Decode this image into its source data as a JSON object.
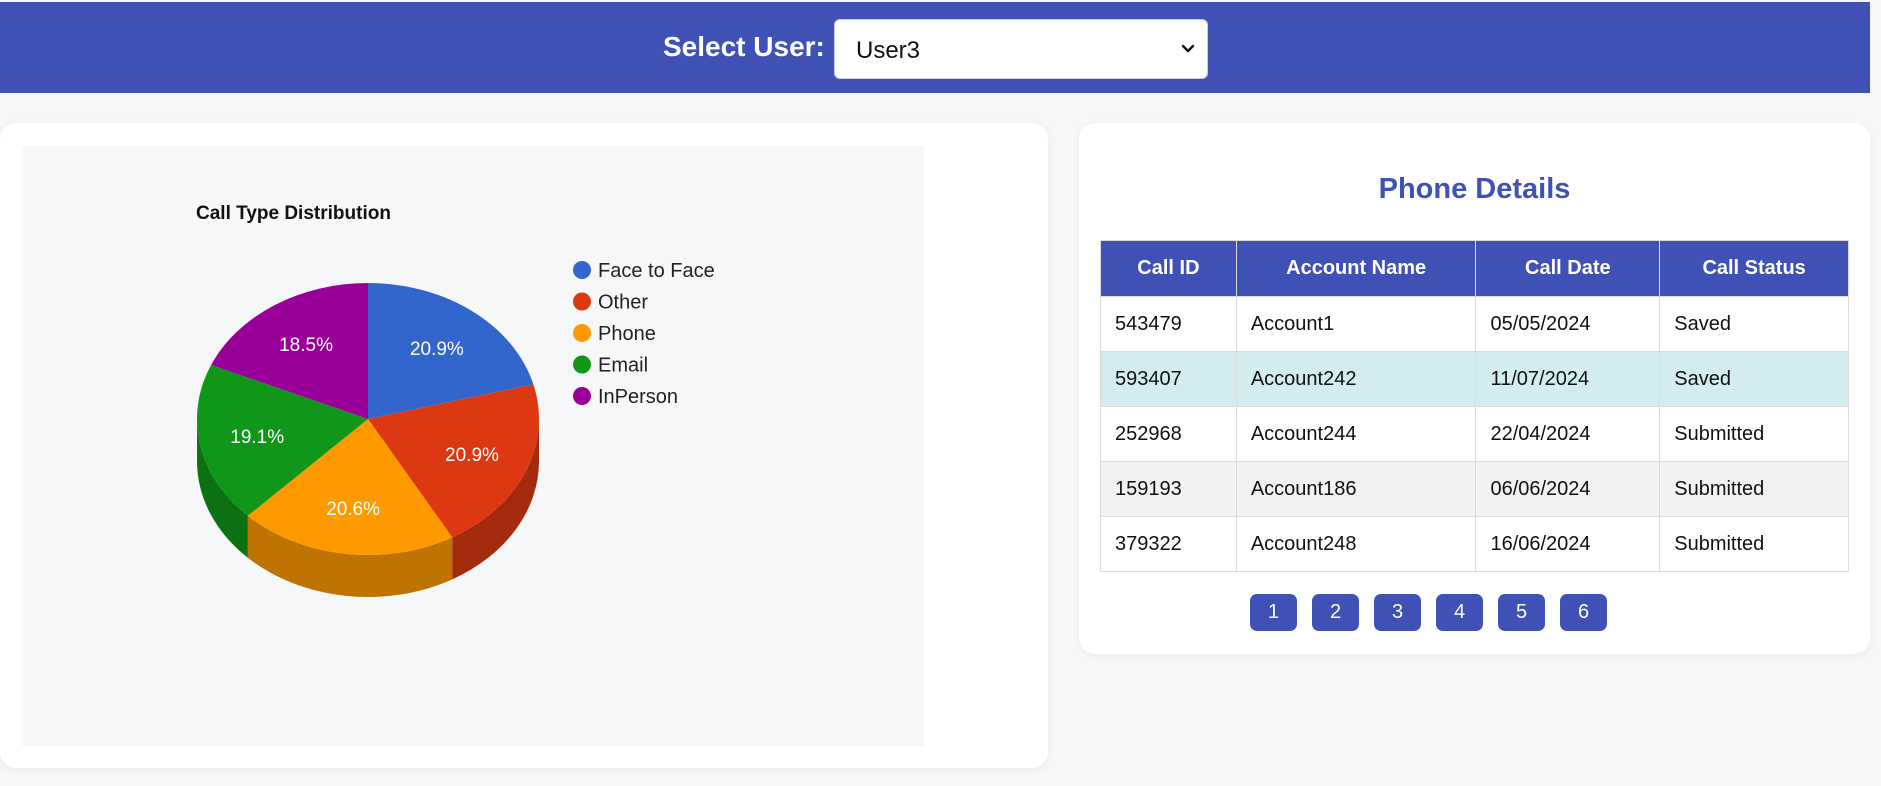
{
  "header": {
    "select_label": "Select User:",
    "selected_user": "User3"
  },
  "chart_data": {
    "type": "pie",
    "title": "Call Type Distribution",
    "legend_position": "right",
    "three_d": true,
    "slices": [
      {
        "label": "Face to Face",
        "value": 20.9,
        "label_text": "20.9%",
        "color": "#3366cc",
        "side_color": "#264d99"
      },
      {
        "label": "Other",
        "value": 20.9,
        "label_text": "20.9%",
        "color": "#dc3912",
        "side_color": "#a52b0e"
      },
      {
        "label": "Phone",
        "value": 20.6,
        "label_text": "20.6%",
        "color": "#ff9900",
        "side_color": "#bf7300"
      },
      {
        "label": "Email",
        "value": 19.1,
        "label_text": "19.1%",
        "color": "#109618",
        "side_color": "#0c7112"
      },
      {
        "label": "InPerson",
        "value": 18.5,
        "label_text": "18.5%",
        "color": "#990099",
        "side_color": "#730073"
      }
    ]
  },
  "phone_details": {
    "title": "Phone Details",
    "columns": [
      "Call ID",
      "Account Name",
      "Call Date",
      "Call Status"
    ],
    "rows": [
      [
        "543479",
        "Account1",
        "05/05/2024",
        "Saved"
      ],
      [
        "593407",
        "Account242",
        "11/07/2024",
        "Saved"
      ],
      [
        "252968",
        "Account244",
        "22/04/2024",
        "Submitted"
      ],
      [
        "159193",
        "Account186",
        "06/06/2024",
        "Submitted"
      ],
      [
        "379322",
        "Account248",
        "16/06/2024",
        "Submitted"
      ]
    ],
    "pages": [
      "1",
      "2",
      "3",
      "4",
      "5",
      "6"
    ]
  },
  "colors": {
    "brand": "#3f51b5",
    "highlight_row": "#d2ecef",
    "alt_row": "#f2f2f2"
  },
  "icons": {
    "select_chevron": "chevron-down-icon"
  }
}
